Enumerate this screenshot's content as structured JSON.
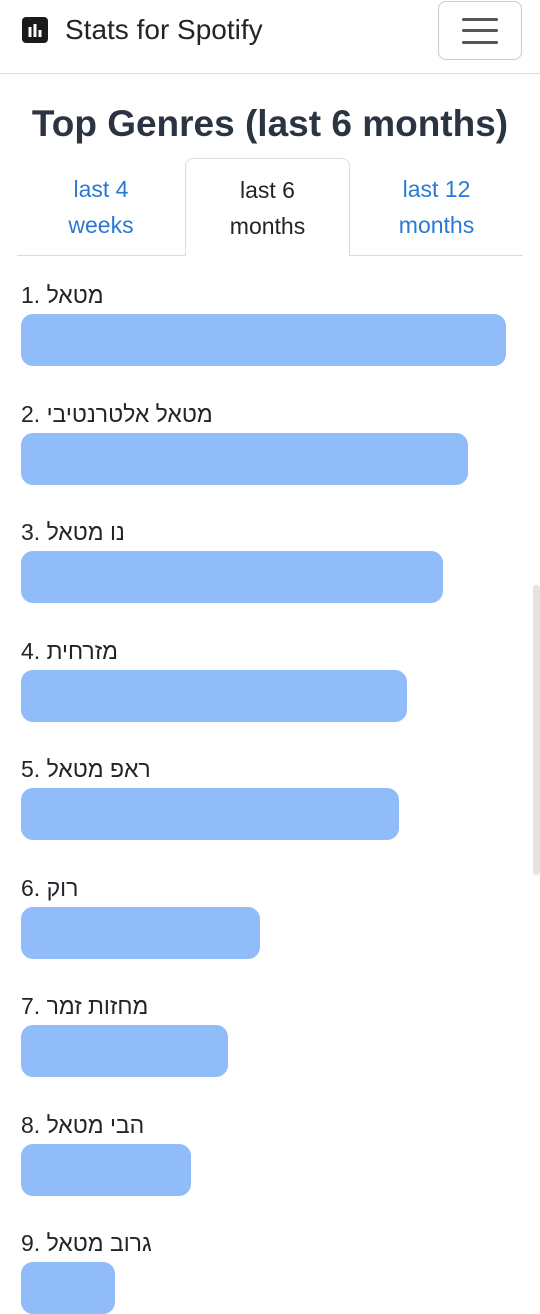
{
  "navbar": {
    "brand": "Stats for Spotify",
    "brand_icon": "bar-chart-icon",
    "menu_icon": "hamburger-menu-icon"
  },
  "page": {
    "title": "Top Genres (last 6 months)"
  },
  "tabs": [
    {
      "label": "last 4\nweeks",
      "active": false
    },
    {
      "label": "last 6\nmonths",
      "active": true
    },
    {
      "label": "last 12\nmonths",
      "active": false
    }
  ],
  "genres": [
    {
      "label": "1. מטאל",
      "value": 1.0
    },
    {
      "label": "2. מטאל אלטרנטיבי",
      "value": 0.904
    },
    {
      "label": "3. נו מטאל",
      "value": 0.838
    },
    {
      "label": "4. מזרחית",
      "value": 0.746
    },
    {
      "label": "5. ראפ מטאל",
      "value": 0.726
    },
    {
      "label": "6. רוק",
      "value": 0.371
    },
    {
      "label": "7. מחזות זמר",
      "value": 0.289
    },
    {
      "label": "8. הבי מטאל",
      "value": 0.194
    },
    {
      "label": "9. גרוב מטאל",
      "value": 0.0
    }
  ],
  "colors": {
    "bar": "#91bcfa",
    "active_tab_text": "#212529",
    "inactive_tab_text": "#2979d6",
    "title": "#2b3542"
  }
}
